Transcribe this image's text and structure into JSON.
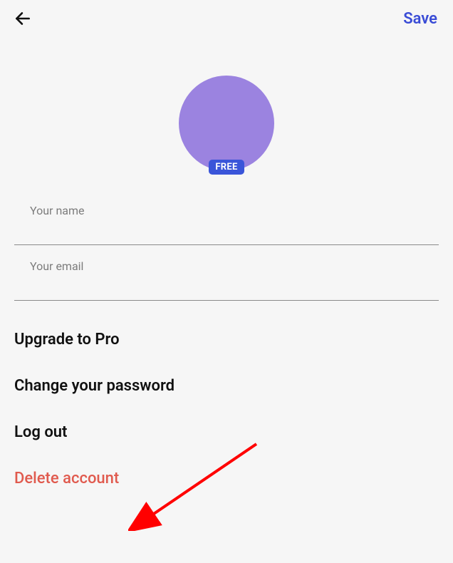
{
  "header": {
    "save_label": "Save"
  },
  "profile": {
    "badge": "FREE"
  },
  "fields": {
    "name_label": "Your name",
    "email_label": "Your email"
  },
  "options": {
    "upgrade": "Upgrade to Pro",
    "change_password": "Change your password",
    "logout": "Log out",
    "delete_account": "Delete account"
  },
  "colors": {
    "accent": "#3a4cd6",
    "avatar": "#9b83e0",
    "danger": "#e05a4e",
    "badge_bg": "#3a55d9",
    "annotation_arrow": "#ff0000"
  }
}
